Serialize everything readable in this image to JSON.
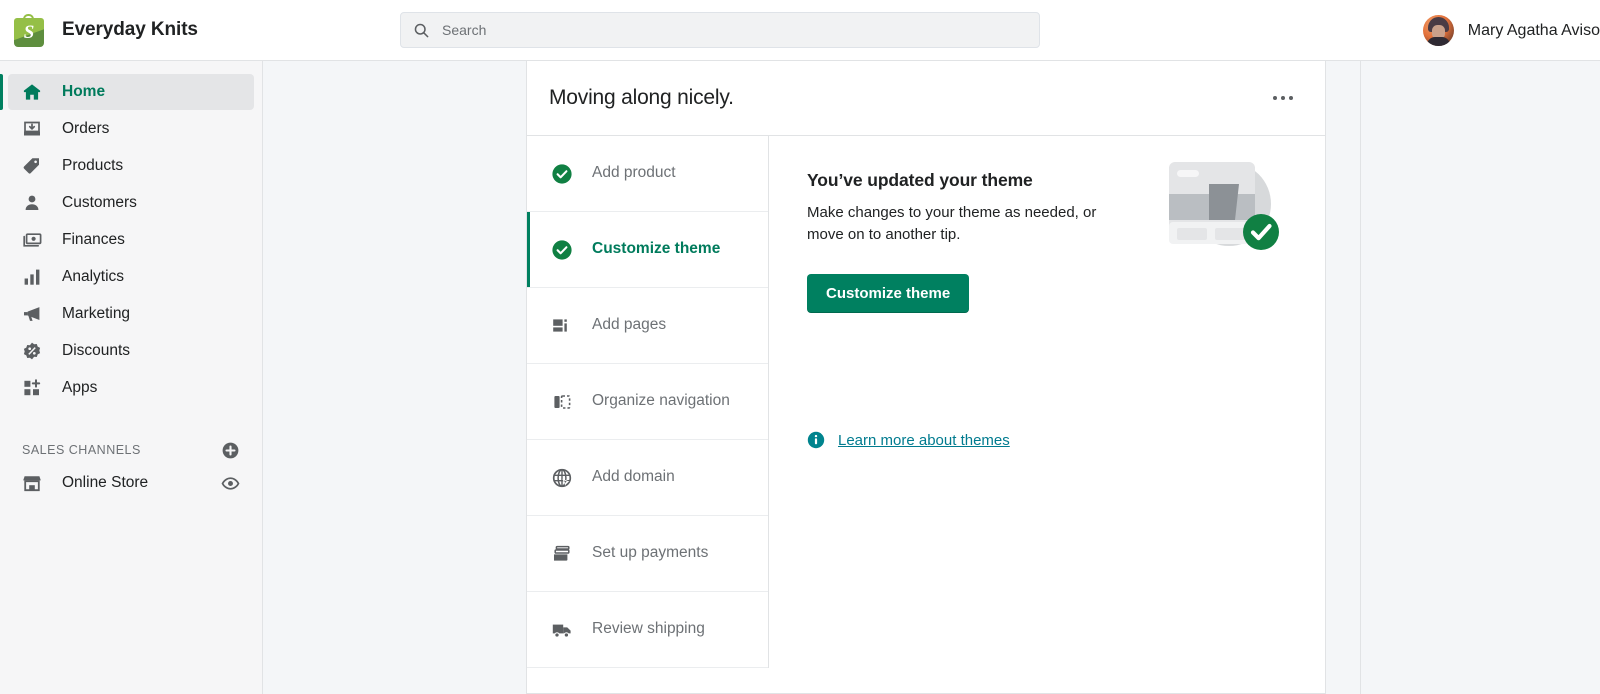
{
  "topbar": {
    "logo_icon": "shopify-bag-icon",
    "store_name": "Everyday Knits",
    "search": {
      "icon": "search-icon",
      "placeholder": "Search",
      "value": ""
    },
    "user": {
      "avatar_icon": "user-avatar",
      "name": "Mary Agatha Aviso"
    }
  },
  "sidebar": {
    "items": [
      {
        "label": "Home",
        "icon": "home-icon",
        "active": true
      },
      {
        "label": "Orders",
        "icon": "orders-inbox-icon",
        "active": false
      },
      {
        "label": "Products",
        "icon": "product-tag-icon",
        "active": false
      },
      {
        "label": "Customers",
        "icon": "customer-person-icon",
        "active": false
      },
      {
        "label": "Finances",
        "icon": "finances-cash-icon",
        "active": false
      },
      {
        "label": "Analytics",
        "icon": "analytics-bars-icon",
        "active": false
      },
      {
        "label": "Marketing",
        "icon": "marketing-megaphone-icon",
        "active": false
      },
      {
        "label": "Discounts",
        "icon": "discounts-percent-icon",
        "active": false
      },
      {
        "label": "Apps",
        "icon": "apps-grid-plus-icon",
        "active": false
      }
    ],
    "sales_channels": {
      "title": "SALES CHANNELS",
      "add_icon": "plus-circle-icon",
      "items": [
        {
          "label": "Online Store",
          "icon": "storefront-icon",
          "trailing_icon": "eye-icon"
        }
      ]
    }
  },
  "card": {
    "title": "Moving along nicely.",
    "more_icon": "ellipsis-icon",
    "checklist": [
      {
        "label": "Add product",
        "icon": "check-circle-icon",
        "state": "done"
      },
      {
        "label": "Customize theme",
        "icon": "check-circle-icon",
        "state": "selected"
      },
      {
        "label": "Add pages",
        "icon": "pages-layout-icon",
        "state": "todo"
      },
      {
        "label": "Organize navigation",
        "icon": "navigation-panel-icon",
        "state": "todo"
      },
      {
        "label": "Add domain",
        "icon": "globe-icon",
        "state": "todo"
      },
      {
        "label": "Set up payments",
        "icon": "payment-card-icon",
        "state": "todo"
      },
      {
        "label": "Review shipping",
        "icon": "shipping-truck-icon",
        "state": "todo"
      }
    ],
    "detail": {
      "title": "You’ve updated your theme",
      "description": "Make changes to your theme as needed, or move on to another tip.",
      "cta_label": "Customize theme",
      "learn_icon": "info-circle-icon",
      "learn_label": "Learn more about themes",
      "illustration_icon": "theme-preview-illustration",
      "illustration_badge_icon": "check-badge-icon"
    }
  },
  "colors": {
    "brand_green": "#008060",
    "active_green": "#007b5c",
    "link_teal": "#007b8f",
    "text": "#202223",
    "subdued": "#6d7175",
    "page_bg": "#f4f6f8",
    "sidebar_bg": "#f6f6f7",
    "border": "#e1e3e5"
  }
}
